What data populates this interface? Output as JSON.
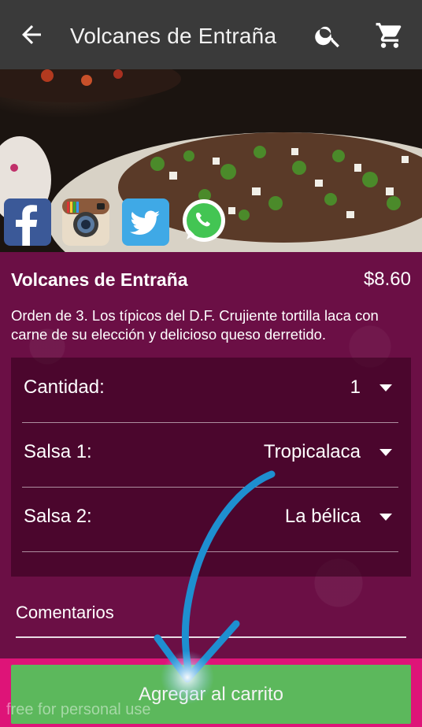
{
  "appbar": {
    "title": "Volcanes de Entraña",
    "back_icon": "arrow-back-icon",
    "search_icon": "search-icon",
    "cart_icon": "shopping-cart-icon",
    "background": "#3a3a3a"
  },
  "share": {
    "icons": [
      "facebook-icon",
      "instagram-icon",
      "twitter-icon",
      "whatsapp-icon"
    ]
  },
  "product": {
    "name": "Volcanes de Entraña",
    "price": "$8.60",
    "description": "Orden de 3. Los típicos del D.F. Crujiente tortilla laca con carne de su elección y delicioso queso derretido."
  },
  "options": [
    {
      "label": "Cantidad:",
      "value": "1"
    },
    {
      "label": "Salsa 1:",
      "value": "Tropicalaca"
    },
    {
      "label": "Salsa 2:",
      "value": "La bélica"
    }
  ],
  "comments": {
    "placeholder": "Comentarios"
  },
  "add_button": {
    "label": "Agregar al carrito",
    "color": "#5cb85c"
  },
  "watermark": "free for personal use",
  "colors": {
    "content_bg": "#6b0f45",
    "button_bar": "#de1478",
    "arrow": "#1e8fd0"
  }
}
